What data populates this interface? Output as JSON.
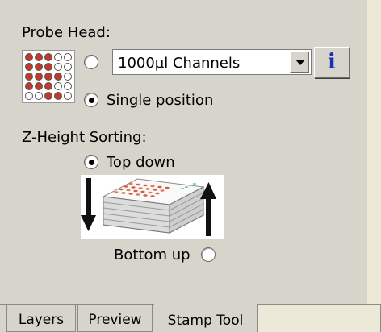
{
  "probe_head": {
    "title": "Probe Head:",
    "channel_select_value": "1000µl Channels",
    "info_button_label": "i",
    "single_position_label": "Single position",
    "channels_radio_selected": false,
    "single_position_selected": true,
    "grid_icon": "probe-grid-icon"
  },
  "z_sorting": {
    "title": "Z-Height Sorting:",
    "top_down_label": "Top down",
    "bottom_up_label": "Bottom up",
    "top_down_selected": true,
    "bottom_up_selected": false,
    "image_icon": "plate-stack-icon"
  },
  "tabs": [
    {
      "label": "Layers",
      "active": false
    },
    {
      "label": "Preview",
      "active": false
    },
    {
      "label": "Stamp Tool",
      "active": true
    }
  ]
}
